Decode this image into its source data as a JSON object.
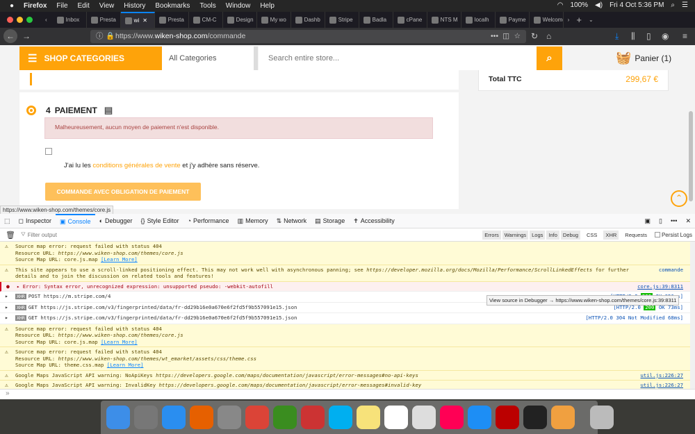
{
  "menubar": {
    "app": "Firefox",
    "items": [
      "File",
      "Edit",
      "View",
      "History",
      "Bookmarks",
      "Tools",
      "Window",
      "Help"
    ],
    "battery": "100%",
    "datetime": "Fri 4 Oct  5:36 PM"
  },
  "tabs": [
    {
      "label": "Inbox"
    },
    {
      "label": "Presta"
    },
    {
      "label": "wi",
      "active": true
    },
    {
      "label": "Presta"
    },
    {
      "label": "CM-C"
    },
    {
      "label": "Design"
    },
    {
      "label": "My wo"
    },
    {
      "label": "Dashb"
    },
    {
      "label": "Stripe"
    },
    {
      "label": "Badla"
    },
    {
      "label": "cPane"
    },
    {
      "label": "NTS M"
    },
    {
      "label": "localh"
    },
    {
      "label": "Payme"
    },
    {
      "label": "Welcome"
    }
  ],
  "nav": {
    "url_prefix": "https://www.",
    "url_domain": "wiken-shop.com",
    "url_path": "/commande"
  },
  "header": {
    "shop_categories": "SHOP CATEGORIES",
    "all_categories": "All Categories",
    "search_placeholder": "Search entire store...",
    "cart": "Panier (1)"
  },
  "summary": {
    "total_label": "Total TTC",
    "total_value": "299,67 €"
  },
  "checkout": {
    "step_number": "4",
    "step_title": "PAIEMENT",
    "alert": "Malheureusement, aucun moyen de paiement n'est disponible.",
    "terms_before": "J'ai lu les ",
    "terms_link": "conditions générales de vente",
    "terms_after": " et j'y adhère sans réserve.",
    "order_button": "COMMANDE AVEC OBLIGATION DE PAIEMENT"
  },
  "status_url": "https://www.wiken-shop.com/themes/core.js",
  "devtools": {
    "tabs": [
      "Inspector",
      "Console",
      "Debugger",
      "Style Editor",
      "Performance",
      "Memory",
      "Network",
      "Storage",
      "Accessibility"
    ],
    "filter_placeholder": "Filter output",
    "filters": [
      "Errors",
      "Warnings",
      "Logs",
      "Info",
      "Debug"
    ],
    "filters2": [
      "CSS",
      "XHR",
      "Requests"
    ],
    "persist": "Persist Logs"
  },
  "console": {
    "m1": {
      "l1": "Source map error: request failed with status 404",
      "l2a": "Resource URL: ",
      "l2b": "https://www.wiken-shop.com/themes/core.js",
      "l3": "Source Map URL: core.js.map ",
      "learn": "[Learn More]"
    },
    "m2": {
      "text": "This site appears to use a scroll-linked positioning effect. This may not work well with asynchronous panning; see ",
      "link": "https://developer.mozilla.org/docs/Mozilla/Performance/ScrollLinkedEffects",
      "text2": " for further details and to join the discussion on related tools and features!",
      "loc": "commande"
    },
    "m3": {
      "text": "Error: Syntax error, unrecognized expression: unsupported pseudo: -webkit-autofill",
      "loc": "core.js:39:8311"
    },
    "x1": {
      "method": "POST",
      "url": "https://m.stripe.com/4",
      "status": "[HTTP/2.0 ",
      "code": "200",
      "rest": " OK 356ms]"
    },
    "x2": {
      "method": "GET",
      "url": "https://js.stripe.com/v3/fingerprinted/data/fr-dd29b16e0a670e6f2fd5f9b557091e15.json",
      "status": "[HTTP/2.0 ",
      "code": "200",
      "rest": " OK 73ms]"
    },
    "x3": {
      "method": "GET",
      "url": "https://js.stripe.com/v3/fingerprinted/data/fr-dd29b16e0a670e6f2fd5f9b557091e15.json",
      "status": "[HTTP/2.0  304 Not Modified 68ms]"
    },
    "m4": {
      "l1": "Source map error: request failed with status 404",
      "l2a": "Resource URL: ",
      "l2b": "https://www.wiken-shop.com/themes/core.js",
      "l3": "Source Map URL: core.js.map ",
      "learn": "[Learn More]"
    },
    "m5": {
      "l1": "Source map error: request failed with status 404",
      "l2a": "Resource URL: ",
      "l2b": "https://www.wiken-shop.com/themes/wt_emarket/assets/css/theme.css",
      "l3": "Source Map URL: theme.css.map ",
      "learn": "[Learn More]"
    },
    "m6": {
      "text": "Google Maps JavaScript API warning: NoApiKeys ",
      "link": "https://developers.google.com/maps/documentation/javascript/error-messages#no-api-keys",
      "loc": "util.js:226:27"
    },
    "m7": {
      "text": "Google Maps JavaScript API warning: InvalidKey ",
      "link": "https://developers.google.com/maps/documentation/javascript/error-messages#invalid-key",
      "loc": "util.js:226:27"
    },
    "tooltip": "View source in Debugger → https://www.wiken-shop.com/themes/core.js:39:8311",
    "prompt": "»"
  },
  "colors": {
    "accent": "#fea30a",
    "devtools_blue": "#0a84ff",
    "warning_bg": "#fffbd6",
    "error": "#d70022"
  }
}
